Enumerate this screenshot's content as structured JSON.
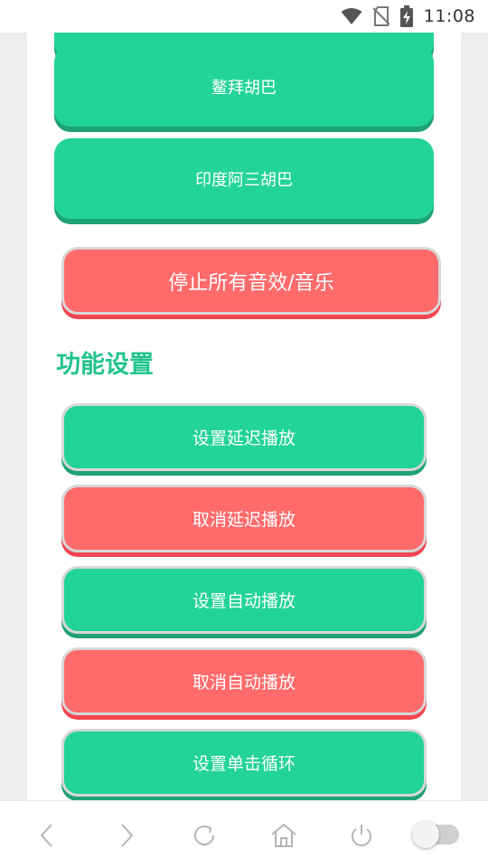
{
  "status_bar": {
    "time": "11:08",
    "icons": [
      "wifi-icon",
      "no-sim-icon",
      "battery-charging-icon"
    ]
  },
  "sound_buttons": [
    {
      "label": "",
      "style": "green"
    },
    {
      "label": "鳌拜胡巴",
      "style": "green"
    },
    {
      "label": "印度阿三胡巴",
      "style": "green"
    }
  ],
  "stop_all": {
    "label": "停止所有音效/音乐",
    "style": "red"
  },
  "settings": {
    "title": "功能设置",
    "buttons": [
      {
        "label": "设置延迟播放",
        "style": "green"
      },
      {
        "label": "取消延迟播放",
        "style": "red"
      },
      {
        "label": "设置自动播放",
        "style": "green"
      },
      {
        "label": "取消自动播放",
        "style": "red"
      },
      {
        "label": "设置单击循环",
        "style": "green"
      }
    ]
  },
  "nav_bar": {
    "icons": [
      "back-icon",
      "forward-icon",
      "refresh-icon",
      "home-icon",
      "power-icon",
      "toggle-switch"
    ]
  },
  "colors": {
    "green": "#22d39a",
    "green_shadow": "#1ea176",
    "red": "#ff6b6b",
    "red_shadow": "#f04650",
    "title_green": "#22c38f"
  }
}
